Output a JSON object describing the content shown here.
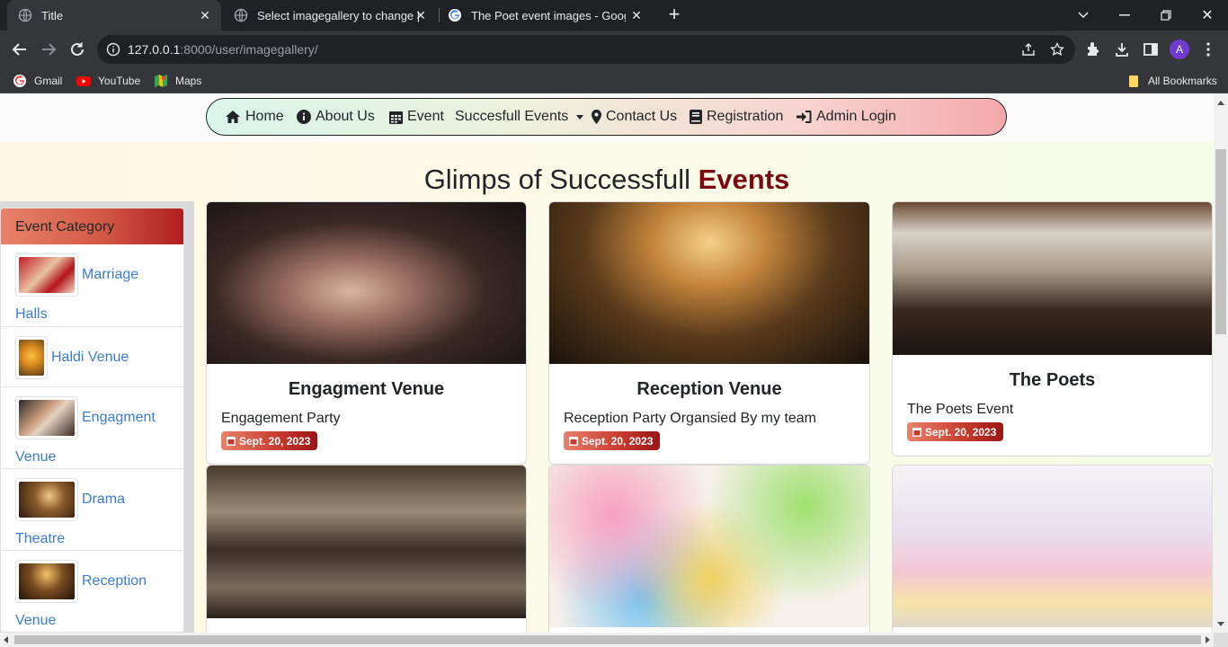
{
  "browser": {
    "tabs": [
      {
        "title": "Title",
        "active": true
      },
      {
        "title": "Select imagegallery to change | D",
        "active": false
      },
      {
        "title": "The Poet event images - Google",
        "active": false
      }
    ],
    "url_host": "127.0.0.1",
    "url_rest": ":8000/user/imagegallery/",
    "profile_initial": "A",
    "bookmarks": [
      "Gmail",
      "YouTube",
      "Maps"
    ],
    "all_bookmarks": "All Bookmarks"
  },
  "nav": {
    "home": "Home",
    "about": "About Us",
    "event": "Event",
    "successful_events": "Succesfull Events",
    "contact": "Contact Us",
    "registration": "Registration",
    "admin_login": "Admin Login"
  },
  "heading": {
    "main": "Glimps of Successfull ",
    "emphasis": "Events"
  },
  "sidebar": {
    "title": "Event Category",
    "items": [
      {
        "label": "Marriage Halls"
      },
      {
        "label": "Haldi Venue"
      },
      {
        "label": "Engagment Venue"
      },
      {
        "label": "Drama Theatre"
      },
      {
        "label": "Reception Venue"
      }
    ]
  },
  "cards": [
    {
      "title": "Engagment Venue",
      "text": "Engagement Party",
      "date": "Sept. 20, 2023"
    },
    {
      "title": "Reception Venue",
      "text": "Reception Party Organsied By my team",
      "date": "Sept. 20, 2023"
    },
    {
      "title": "The Poets",
      "text": "The Poets Event",
      "date": "Sept. 20, 2023"
    }
  ],
  "colors": {
    "accent_dark_red": "#7a0a10",
    "link_blue": "#3a7bd5",
    "badge_red": "#c63a2e"
  }
}
